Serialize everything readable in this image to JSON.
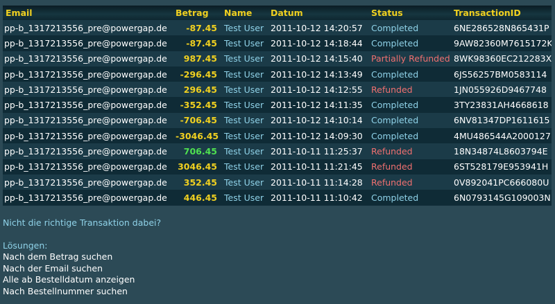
{
  "table": {
    "headers": [
      "Email",
      "Betrag",
      "Name",
      "Datum",
      "Status",
      "TransactionID"
    ],
    "rows": [
      {
        "email": "pp-b_1317213556_pre@powergap.de",
        "amount": "-87.45",
        "amount_color": "yellow",
        "name": "Test User",
        "date": "2011-10-12 14:20:57",
        "status": "Completed",
        "status_type": "completed",
        "txid": "6NE286528N865431P"
      },
      {
        "email": "pp-b_1317213556_pre@powergap.de",
        "amount": "-87.45",
        "amount_color": "yellow",
        "name": "Test User",
        "date": "2011-10-12 14:18:44",
        "status": "Completed",
        "status_type": "completed",
        "txid": "9AW82360M7615172K"
      },
      {
        "email": "pp-b_1317213556_pre@powergap.de",
        "amount": "987.45",
        "amount_color": "yellow",
        "name": "Test User",
        "date": "2011-10-12 14:15:40",
        "status": "Partially Refunded",
        "status_type": "refunded",
        "txid": "8WK98360EC212283X"
      },
      {
        "email": "pp-b_1317213556_pre@powergap.de",
        "amount": "-296.45",
        "amount_color": "yellow",
        "name": "Test User",
        "date": "2011-10-12 14:13:49",
        "status": "Completed",
        "status_type": "completed",
        "txid": "6JS56257BM0583114"
      },
      {
        "email": "pp-b_1317213556_pre@powergap.de",
        "amount": "296.45",
        "amount_color": "yellow",
        "name": "Test User",
        "date": "2011-10-12 14:12:55",
        "status": "Refunded",
        "status_type": "refunded",
        "txid": "1JN055926D9467748"
      },
      {
        "email": "pp-b_1317213556_pre@powergap.de",
        "amount": "-352.45",
        "amount_color": "yellow",
        "name": "Test User",
        "date": "2011-10-12 14:11:35",
        "status": "Completed",
        "status_type": "completed",
        "txid": "3TY23831AH4668618"
      },
      {
        "email": "pp-b_1317213556_pre@powergap.de",
        "amount": "-706.45",
        "amount_color": "yellow",
        "name": "Test User",
        "date": "2011-10-12 14:10:14",
        "status": "Completed",
        "status_type": "completed",
        "txid": "6NV81347DP1611615"
      },
      {
        "email": "pp-b_1317213556_pre@powergap.de",
        "amount": "-3046.45",
        "amount_color": "yellow",
        "name": "Test User",
        "date": "2011-10-12 14:09:30",
        "status": "Completed",
        "status_type": "completed",
        "txid": "4MU486544A2000127"
      },
      {
        "email": "pp-b_1317213556_pre@powergap.de",
        "amount": "706.45",
        "amount_color": "green",
        "name": "Test User",
        "date": "2011-10-11 11:25:37",
        "status": "Refunded",
        "status_type": "refunded",
        "txid": "18N34874L8603794E"
      },
      {
        "email": "pp-b_1317213556_pre@powergap.de",
        "amount": "3046.45",
        "amount_color": "yellow",
        "name": "Test User",
        "date": "2011-10-11 11:21:45",
        "status": "Refunded",
        "status_type": "refunded",
        "txid": "6ST528179E953941H"
      },
      {
        "email": "pp-b_1317213556_pre@powergap.de",
        "amount": "352.45",
        "amount_color": "yellow",
        "name": "Test User",
        "date": "2011-10-11 11:14:28",
        "status": "Refunded",
        "status_type": "refunded",
        "txid": "0V892041PC666080U"
      },
      {
        "email": "pp-b_1317213556_pre@powergap.de",
        "amount": "446.45",
        "amount_color": "yellow",
        "name": "Test User",
        "date": "2011-10-11 11:10:42",
        "status": "Completed",
        "status_type": "completed",
        "txid": "6N0793145G109003N"
      }
    ]
  },
  "help": {
    "question": "Nicht die richtige Transaktion dabei?",
    "solutions_title": "Lösungen:",
    "links": [
      "Nach dem Betrag suchen",
      "Nach der Email suchen",
      "Alle ab Bestelldatum anzeigen",
      "Nach Bestellnummer suchen"
    ]
  },
  "colors": {
    "background": "#2c4a56",
    "header_text": "#f0d020",
    "completed": "#8fd2e8",
    "refunded": "#f07070",
    "amount_green": "#4fe050"
  }
}
